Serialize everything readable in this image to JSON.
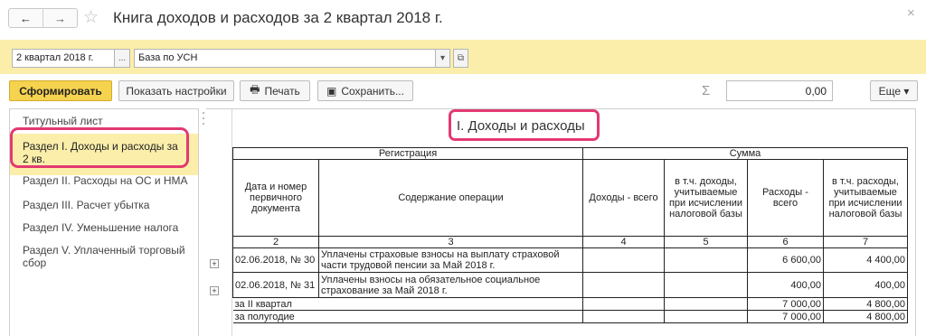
{
  "window": {
    "title": "Книга доходов и расходов за 2 квартал 2018 г.",
    "back_icon": "←",
    "forward_icon": "→",
    "favorite_icon": "☆",
    "close_icon": "×"
  },
  "filters": {
    "period": "2 квартал 2018 г.",
    "period_select": "...",
    "org": "База по УСН",
    "org_dropdown": "▾",
    "org_open": "⧉"
  },
  "toolbar": {
    "generate": "Сформировать",
    "settings": "Показать настройки",
    "print": "Печать",
    "print_icon": "🖶",
    "save": "Сохранить...",
    "save_icon": "▣",
    "sigma": "Σ",
    "sum": "0,00",
    "more": "Еще ▾"
  },
  "sidebar": {
    "items": [
      "Титульный лист",
      "Раздел I. Доходы и расходы за 2 кв.",
      "Раздел II. Расходы на ОС и НМА",
      "Раздел III. Расчет убытка",
      "Раздел IV. Уменьшение налога",
      "Раздел V. Уплаченный торговый сбор"
    ],
    "active_index": 1
  },
  "report": {
    "title": "I. Доходы и расходы",
    "expand_icon": "+",
    "group_registration": "Регистрация",
    "group_sum": "Сумма",
    "columns": [
      "Дата и номер первичного документа",
      "Содержание операции",
      "Доходы - всего",
      "в т.ч. доходы, учитываемые при исчислении налоговой базы",
      "Расходы - всего",
      "в т.ч. расходы, учитываемые при исчислении налоговой базы"
    ],
    "col_numbers": [
      "2",
      "3",
      "4",
      "5",
      "6",
      "7"
    ],
    "rows": [
      {
        "doc": "02.06.2018, № 30",
        "content": "Уплачены страховые взносы на выплату страховой части трудовой пенсии за Май 2018 г.",
        "income": "",
        "income_tax": "",
        "expense": "6 600,00",
        "expense_tax": "4 400,00"
      },
      {
        "doc": "02.06.2018, № 31",
        "content": "Уплачены взносы на обязательное социальное страхование за Май 2018 г.",
        "income": "",
        "income_tax": "",
        "expense": "400,00",
        "expense_tax": "400,00"
      }
    ],
    "totals": [
      {
        "label": "за II квартал",
        "income": "",
        "income_tax": "",
        "expense": "7 000,00",
        "expense_tax": "4 800,00"
      },
      {
        "label": "за полугодие",
        "income": "",
        "income_tax": "",
        "expense": "7 000,00",
        "expense_tax": "4 800,00"
      }
    ]
  }
}
